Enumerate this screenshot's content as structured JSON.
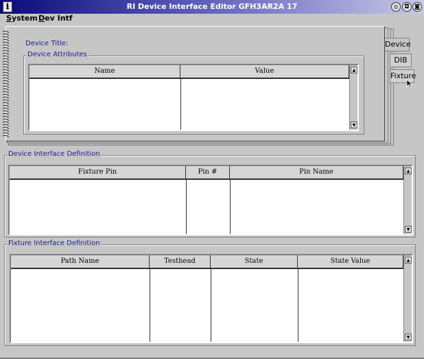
{
  "window": {
    "title": "RI Device Interface Editor GFH3AR2A 17",
    "app_icon_glyph": "ℹ",
    "buttons": [
      "◎",
      "◘",
      "◙"
    ]
  },
  "menu": {
    "system_underline": "S",
    "system_rest": "ystem",
    "devintf_underline": "D",
    "devintf_rest": "ev Intf"
  },
  "notebook": {
    "tabs": {
      "device": "Device",
      "dib": "DIB",
      "fixture": "Fixture"
    },
    "device_title_label": "Device Title:",
    "device_attributes": {
      "group_title": "Device Attributes",
      "columns": [
        "Name",
        "Value"
      ]
    }
  },
  "device_interface": {
    "group_title": "Device Interface Definition",
    "columns": [
      "Fixture Pin",
      "Pin #",
      "Pin Name"
    ]
  },
  "fixture_interface": {
    "group_title": "Fixture Interface Definition",
    "columns": [
      "Path Name",
      "Testhead",
      "State",
      "State Value"
    ]
  },
  "scroll": {
    "up": "▲",
    "down": "▼"
  }
}
